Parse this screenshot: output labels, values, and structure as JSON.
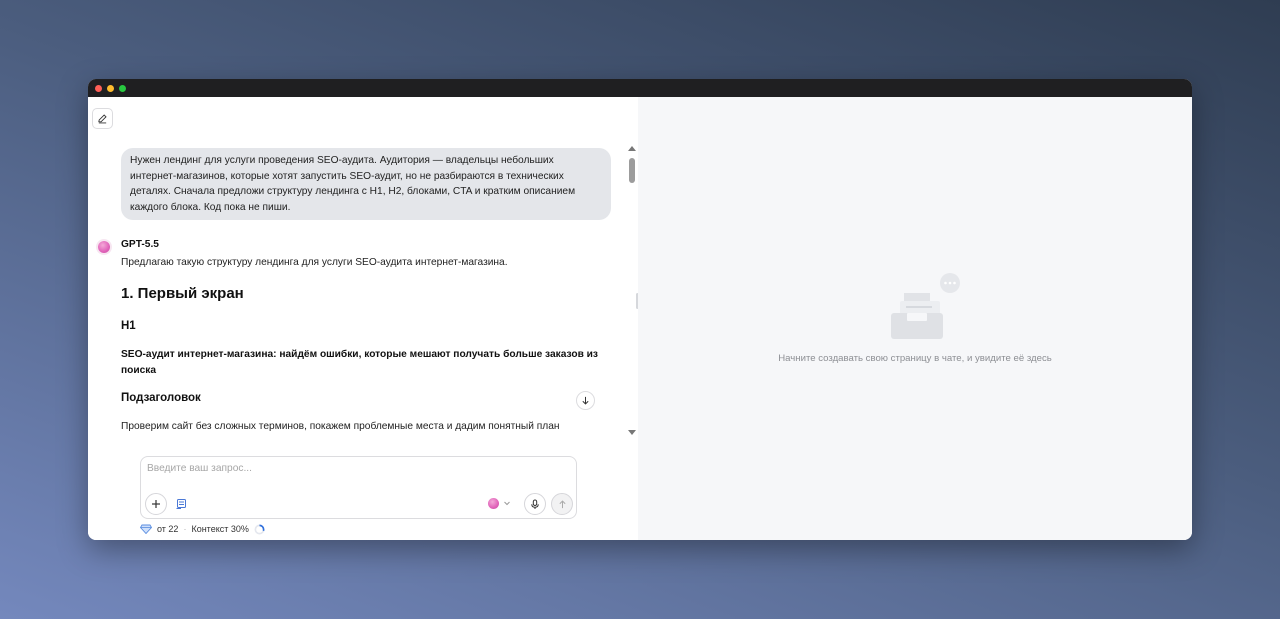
{
  "composer": {
    "placeholder": "Введите ваш запрос..."
  },
  "chat": {
    "user_message": "Нужен лендинг для услуги проведения SEO-аудита. Аудитория — владельцы небольших интернет-магазинов, которые хотят запустить SEO-аудит, но не разбираются в технических деталях. Сначала предложи структуру лендинга с H1, H2, блоками, CTA и кратким описанием каждого блока. Код пока не пиши.",
    "model_name": "GPT-5.5",
    "intro": "Предлагаю такую структуру лендинга для услуги SEO-аудита интернет-магазина.",
    "section_heading": "1. Первый экран",
    "h1_label": "H1",
    "h1_text": "SEO-аудит интернет-магазина: найдём ошибки, которые мешают получать больше заказов из поиска",
    "subheading_label": "Подзаголовок",
    "subheading_text": "Проверим сайт без сложных терминов, покажем проблемные места и дадим понятный план"
  },
  "footer": {
    "credits": "от 22",
    "context": "Контекст 30%",
    "context_progress": 0.3
  },
  "preview": {
    "empty_text": "Начните создавать свою страницу в чате, и увидите её здесь"
  },
  "icons": {
    "edit": "pencil-icon",
    "scroll_down": "arrow-down-icon",
    "add": "plus-icon",
    "tools": "tools-icon",
    "mic": "microphone-icon",
    "send": "arrow-up-icon",
    "credits": "diamond-icon"
  },
  "colors": {
    "titlebar": "#1f1f21",
    "user_bubble": "#e4e6ea",
    "preview_bg": "#f6f7f9",
    "model_accent": "#e062b9",
    "progress": "#2f6fdc"
  }
}
